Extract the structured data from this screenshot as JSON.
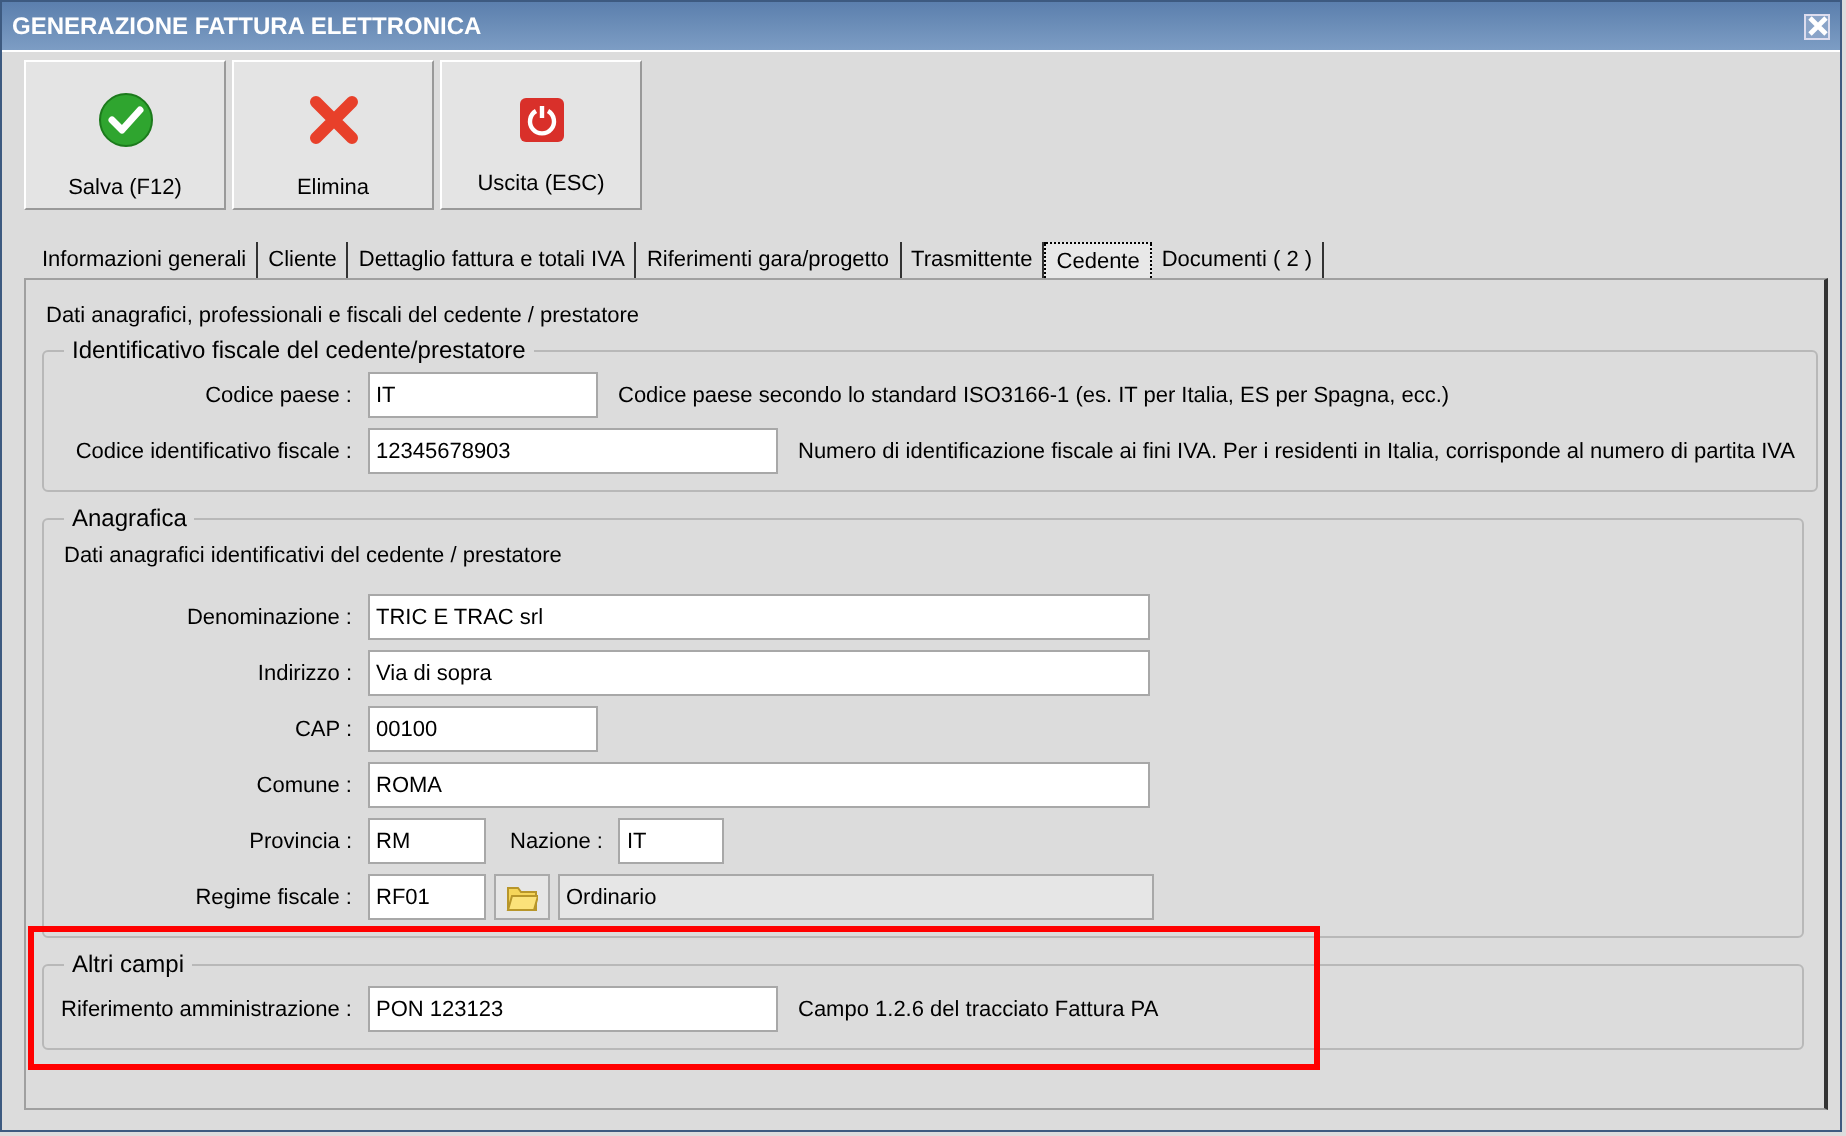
{
  "window": {
    "title": "GENERAZIONE FATTURA ELETTRONICA"
  },
  "toolbar": [
    {
      "label": "Salva (F12)",
      "kind": "save"
    },
    {
      "label": "Elimina",
      "kind": "delete"
    },
    {
      "label": "Uscita (ESC)",
      "kind": "exit"
    }
  ],
  "tabs": [
    {
      "label": "Informazioni generali",
      "selected": false
    },
    {
      "label": "Cliente",
      "selected": false
    },
    {
      "label": "Dettaglio fattura e totali IVA",
      "selected": false
    },
    {
      "label": "Riferimenti gara/progetto",
      "selected": false
    },
    {
      "label": "Trasmittente",
      "selected": false
    },
    {
      "label": "Cedente",
      "selected": true
    },
    {
      "label": "Documenti ( 2 )",
      "selected": false
    }
  ],
  "panel": {
    "description": "Dati anagrafici, professionali e fiscali del cedente / prestatore",
    "sections": [
      {
        "title": "Identificativo fiscale del cedente/prestatore",
        "highlighted": false,
        "rows": [
          {
            "kind": "field",
            "label": "Codice paese :",
            "value": "IT",
            "note": "Codice paese secondo lo standard ISO3166-1 (es. IT per Italia, ES per Spagna, ecc.)"
          },
          {
            "kind": "field",
            "label": "Codice identificativo fiscale :",
            "value": "12345678903",
            "note": "Numero di identificazione fiscale ai fini IVA. Per i residenti in Italia, corrisponde al numero di partita IVA"
          }
        ]
      },
      {
        "title": "Anagrafica",
        "highlighted": false,
        "description": "Dati anagrafici identificativi del cedente / prestatore",
        "rows": [
          {
            "kind": "field",
            "label": "Denominazione :",
            "value": "TRIC E TRAC srl"
          },
          {
            "kind": "field",
            "label": "Indirizzo :",
            "value": "Via di sopra"
          },
          {
            "kind": "field",
            "label": "CAP :",
            "value": "00100"
          },
          {
            "kind": "field",
            "label": "Comune :",
            "value": "ROMA"
          },
          {
            "kind": "pair",
            "label": "Provincia :",
            "value": "RM",
            "label2": "Nazione :",
            "value2": "IT"
          },
          {
            "kind": "lookup",
            "label": "Regime fiscale :",
            "value": "RF01",
            "description": "Ordinario"
          }
        ]
      },
      {
        "title": "Altri campi",
        "highlighted": true,
        "rows": [
          {
            "kind": "field",
            "label": "Riferimento amministrazione :",
            "value": "PON 123123",
            "note": "Campo 1.2.6 del tracciato Fattura PA"
          }
        ]
      }
    ]
  }
}
